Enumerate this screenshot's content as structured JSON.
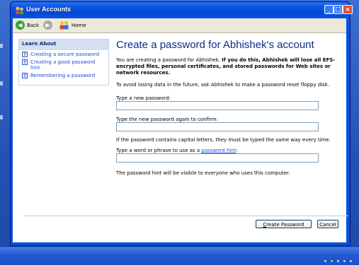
{
  "window": {
    "title": "User Accounts",
    "buttons": {
      "minimize": "_",
      "maximize": "□",
      "close": "×"
    }
  },
  "toolbar": {
    "back_label": "Back",
    "home_label": "Home",
    "back_icon": "back-arrow-icon",
    "forward_icon": "forward-arrow-icon",
    "home_icon": "home-users-icon"
  },
  "sidebar": {
    "header": "Learn About",
    "items": [
      {
        "label": "Creating a secure password",
        "icon": "help-icon"
      },
      {
        "label": "Creating a good password hint",
        "icon": "help-icon"
      },
      {
        "label": "Remembering a password",
        "icon": "help-icon"
      }
    ]
  },
  "content": {
    "heading": "Create a password for Abhishek's account",
    "intro_plain": "You are creating a password for Abhishek.",
    "intro_bold": "If you do this, Abhishek will lose all EFS-encrypted files, personal certificates, and stored passwords for Web sites or network resources.",
    "reset_note": "To avoid losing data in the future, ask Abhishek to make a password reset floppy disk.",
    "new_password_label": "Type a new password:",
    "confirm_password_label": "Type the new password again to confirm:",
    "capital_letters_note": "If the password contains capital letters, they must be typed the same way every time.",
    "hint_label_prefix": "Type a word or phrase to use as a",
    "hint_link": "password hint",
    "hint_label_suffix": ":",
    "hint_visibility_note": "The password hint will be visible to everyone who uses this computer."
  },
  "buttons": {
    "create_password": "Create Password",
    "cancel": "Cancel"
  },
  "colors": {
    "title_bar": "#0a55e3",
    "heading": "#0c2c86",
    "link": "#1c4ed7",
    "desktop": "#2452b4"
  }
}
